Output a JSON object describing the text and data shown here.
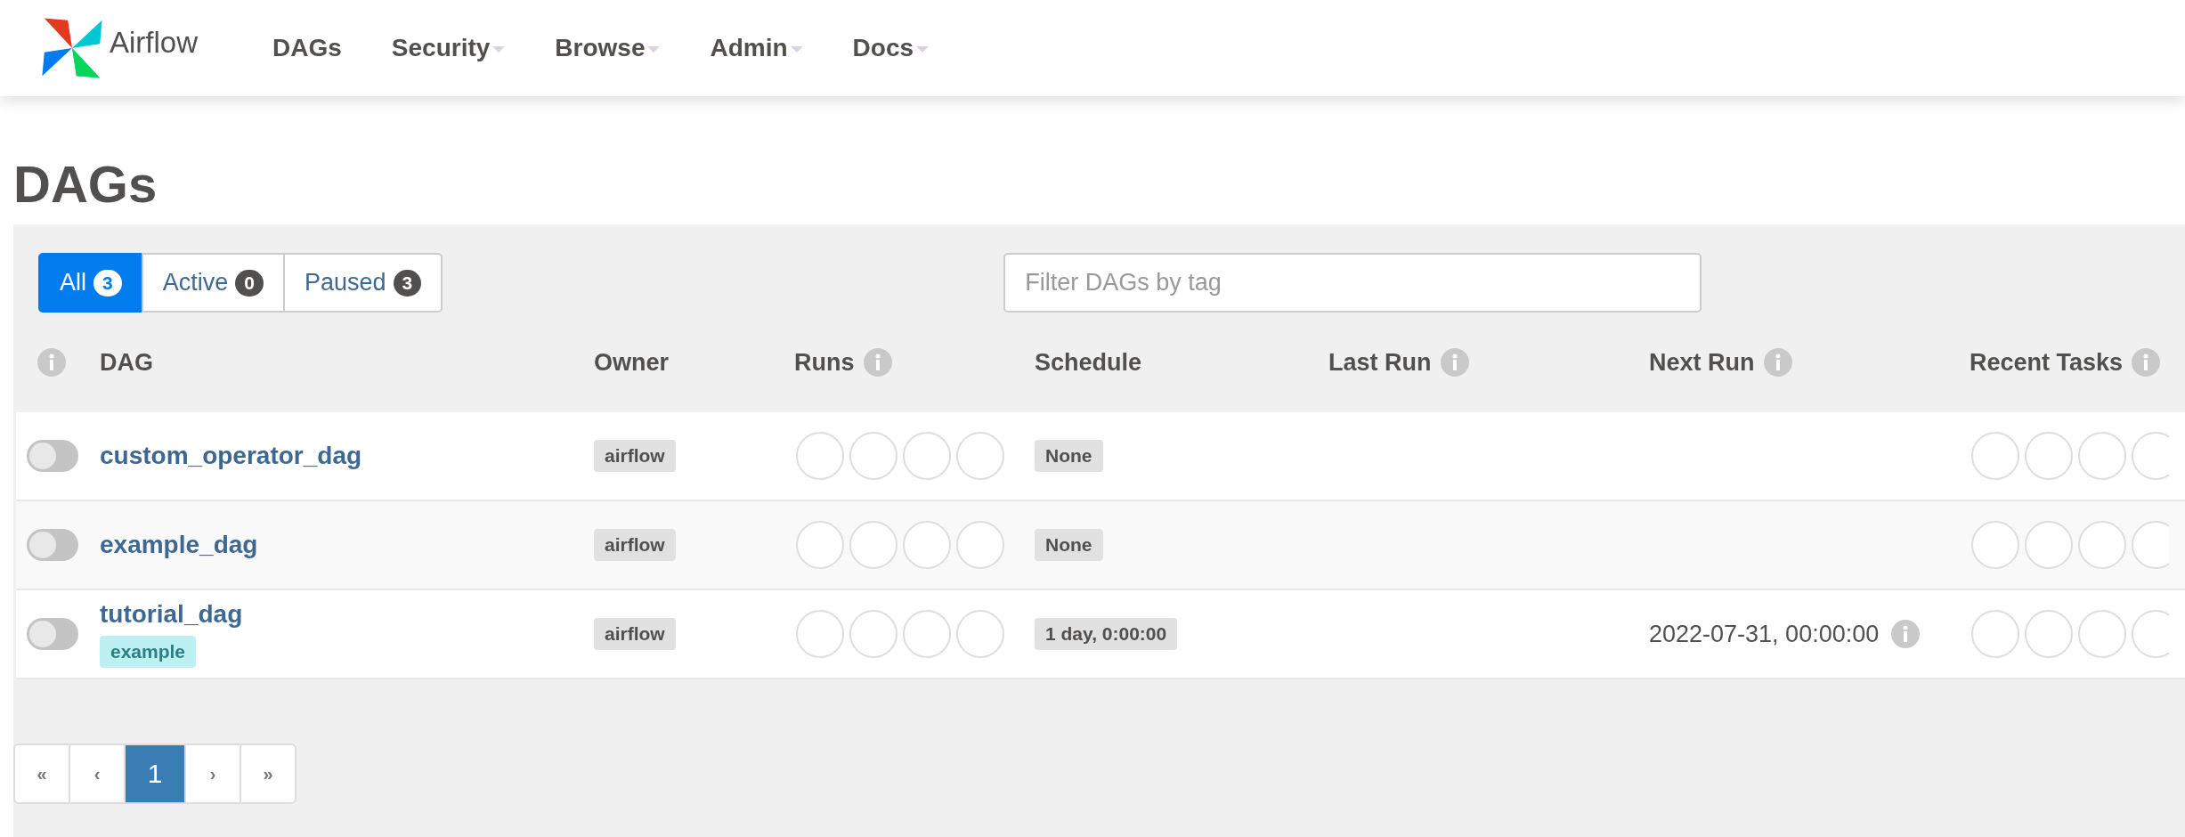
{
  "navbar": {
    "brand": "Airflow",
    "items": [
      {
        "label": "DAGs",
        "dropdown": false
      },
      {
        "label": "Security",
        "dropdown": true
      },
      {
        "label": "Browse",
        "dropdown": true
      },
      {
        "label": "Admin",
        "dropdown": true
      },
      {
        "label": "Docs",
        "dropdown": true
      }
    ]
  },
  "page_title": "DAGs",
  "filter_tabs": [
    {
      "label": "All",
      "count": "3",
      "selected": true
    },
    {
      "label": "Active",
      "count": "0",
      "selected": false
    },
    {
      "label": "Paused",
      "count": "3",
      "selected": false
    }
  ],
  "tag_filter": {
    "placeholder": "Filter DAGs by tag"
  },
  "table": {
    "columns": [
      {
        "info": true
      },
      {
        "label": "DAG",
        "info": false
      },
      {
        "label": "Owner",
        "info": false
      },
      {
        "label": "Runs",
        "info": true
      },
      {
        "label": "Schedule",
        "info": false
      },
      {
        "label": "Last Run",
        "info": true
      },
      {
        "label": "Next Run",
        "info": true
      },
      {
        "label": "Recent Tasks",
        "info": true
      }
    ],
    "rows": [
      {
        "active": false,
        "dag": "custom_operator_dag",
        "owner": "airflow",
        "schedule": "None"
      },
      {
        "active": false,
        "dag": "example_dag",
        "owner": "airflow",
        "schedule": "None"
      },
      {
        "active": false,
        "dag": "tutorial_dag",
        "tags": [
          "example"
        ],
        "owner": "airflow",
        "schedule": "1 day, 0:00:00",
        "next_run": "2022-07-31, 00:00:00"
      }
    ]
  },
  "pagination": [
    {
      "label": "«",
      "selected": false
    },
    {
      "label": "‹",
      "selected": false
    },
    {
      "label": "1",
      "selected": true
    },
    {
      "label": "›",
      "selected": false
    },
    {
      "label": "»",
      "selected": false
    }
  ]
}
